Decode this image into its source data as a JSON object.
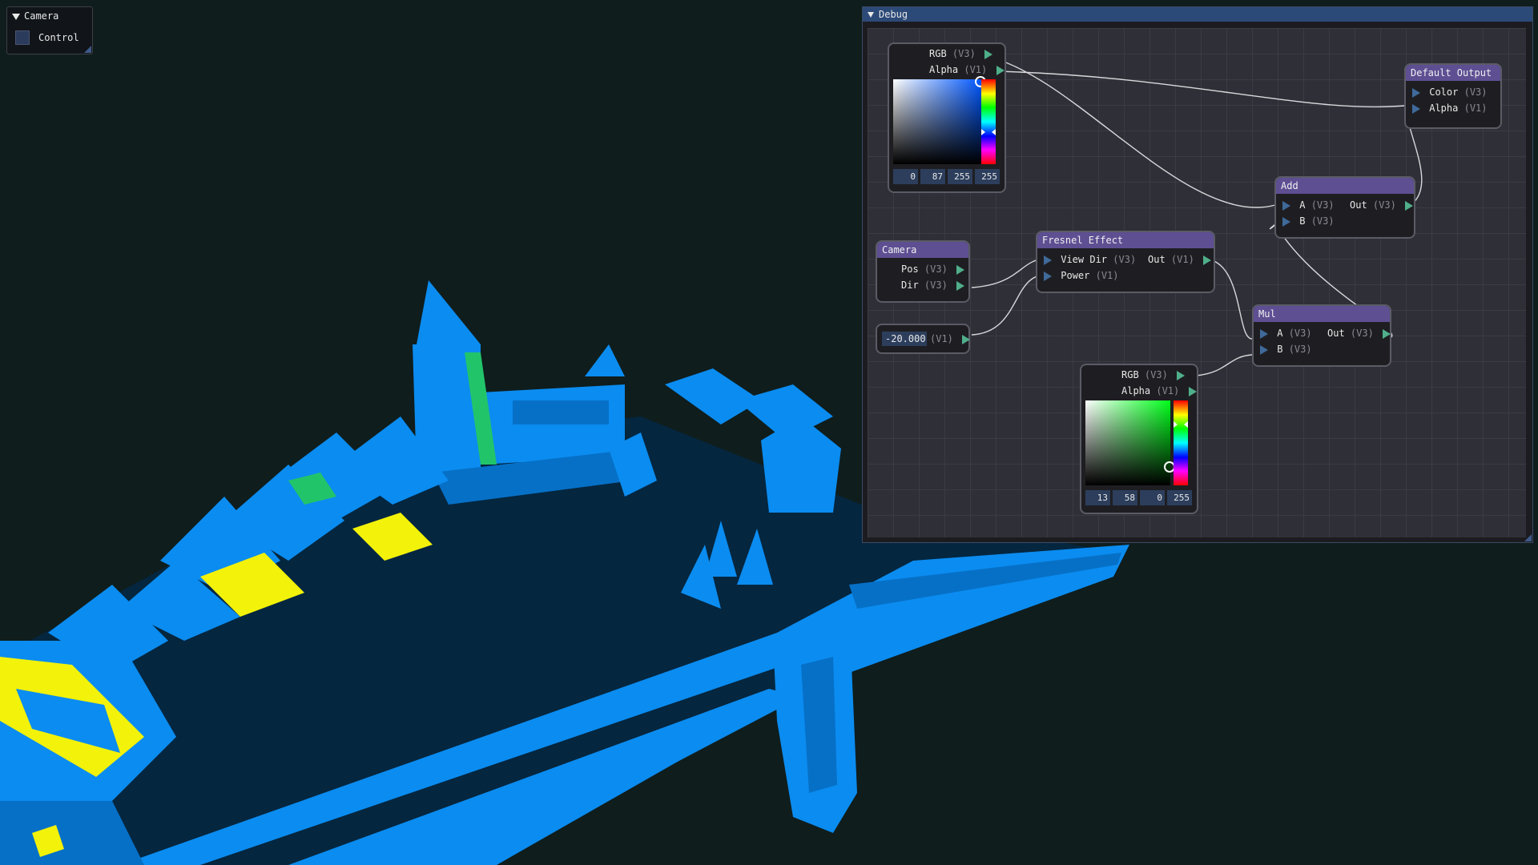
{
  "colors": {
    "background": "#0f1d1d",
    "mesh_blue": "#0b8cf0",
    "mesh_highlight": "#f2f20a",
    "node_header": "#5e4f93",
    "window_title": "#2c4a78"
  },
  "camera_window": {
    "title": "Camera",
    "control_label": "Control",
    "icons": [
      "collapse-arrow-icon",
      "resize-grip-icon"
    ]
  },
  "debug_window": {
    "title": "Debug",
    "nodes": {
      "color_picker_1": {
        "outputs": [
          {
            "label": "RGB",
            "type": "(V3)"
          },
          {
            "label": "Alpha",
            "type": "(V1)"
          }
        ],
        "values": [
          "0",
          "87",
          "255",
          "255"
        ]
      },
      "color_picker_2": {
        "outputs": [
          {
            "label": "RGB",
            "type": "(V3)"
          },
          {
            "label": "Alpha",
            "type": "(V1)"
          }
        ],
        "values": [
          "13",
          "58",
          "0",
          "255"
        ]
      },
      "default_output": {
        "title": "Default Output",
        "inputs": [
          {
            "label": "Color",
            "type": "(V3)"
          },
          {
            "label": "Alpha",
            "type": "(V1)"
          }
        ]
      },
      "add": {
        "title": "Add",
        "inputs": [
          {
            "label": "A",
            "type": "(V3)"
          },
          {
            "label": "B",
            "type": "(V3)"
          }
        ],
        "output": {
          "label": "Out",
          "type": "(V3)"
        }
      },
      "camera": {
        "title": "Camera",
        "outputs": [
          {
            "label": "Pos",
            "type": "(V3)"
          },
          {
            "label": "Dir",
            "type": "(V3)"
          }
        ]
      },
      "fresnel": {
        "title": "Fresnel Effect",
        "inputs": [
          {
            "label": "View Dir",
            "type": "(V3)"
          },
          {
            "label": "Power",
            "type": "(V1)"
          }
        ],
        "output": {
          "label": "Out",
          "type": "(V1)"
        }
      },
      "float_const": {
        "value": "-20.000",
        "type": "(V1)"
      },
      "mul": {
        "title": "Mul",
        "inputs": [
          {
            "label": "A",
            "type": "(V3)"
          },
          {
            "label": "B",
            "type": "(V3)"
          }
        ],
        "output": {
          "label": "Out",
          "type": "(V3)"
        }
      }
    }
  }
}
